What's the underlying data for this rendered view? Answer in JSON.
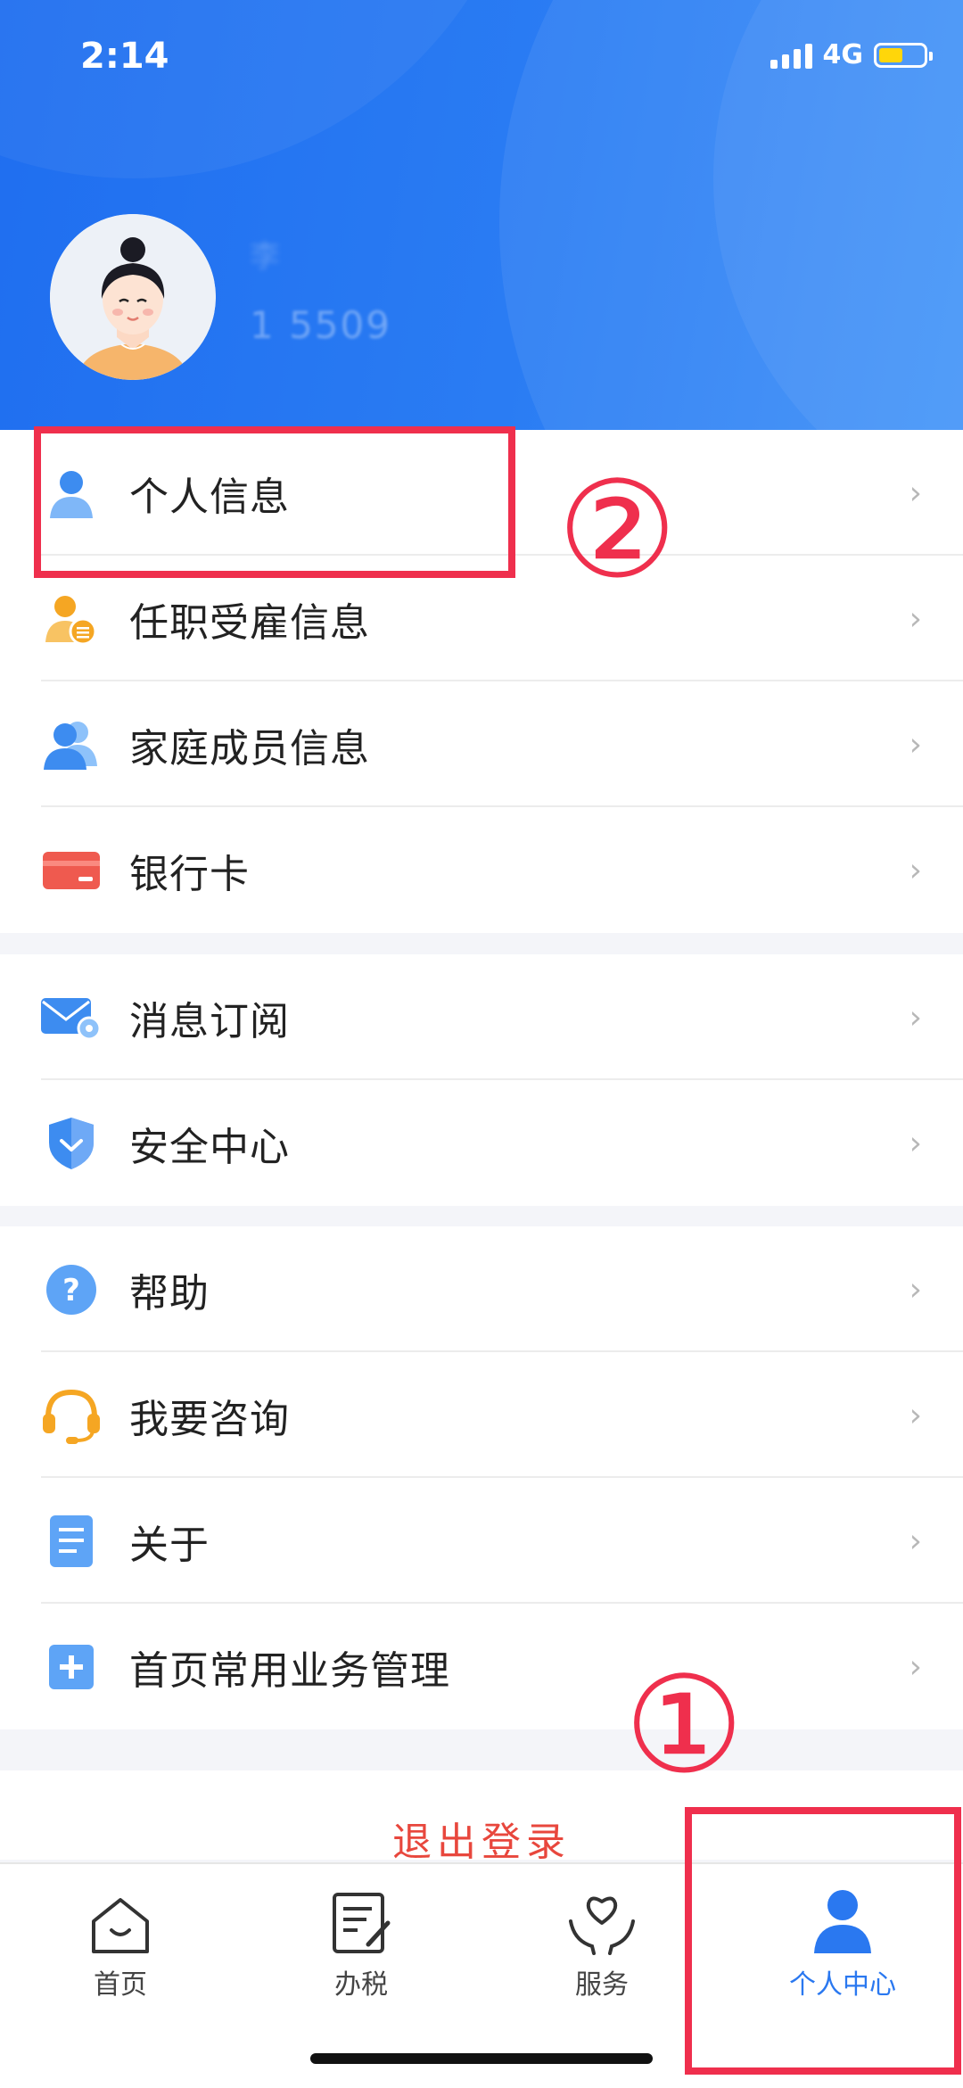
{
  "status_bar": {
    "time": "2:14",
    "network": "4G"
  },
  "profile": {
    "name_blurred": "李",
    "phone_masked": "1     5509"
  },
  "menu_groups": [
    [
      {
        "label": "个人信息",
        "icon": "person-icon"
      },
      {
        "label": "任职受雇信息",
        "icon": "employment-icon"
      },
      {
        "label": "家庭成员信息",
        "icon": "family-icon"
      },
      {
        "label": "银行卡",
        "icon": "bank-card-icon"
      }
    ],
    [
      {
        "label": "消息订阅",
        "icon": "mail-settings-icon"
      },
      {
        "label": "安全中心",
        "icon": "shield-icon"
      }
    ],
    [
      {
        "label": "帮助",
        "icon": "help-icon"
      },
      {
        "label": "我要咨询",
        "icon": "headset-icon"
      },
      {
        "label": "关于",
        "icon": "document-icon"
      },
      {
        "label": "首页常用业务管理",
        "icon": "plus-square-icon"
      }
    ]
  ],
  "logout_label": "退出登录",
  "tabbar": [
    {
      "label": "首页",
      "icon": "home-icon"
    },
    {
      "label": "办税",
      "icon": "tax-form-icon"
    },
    {
      "label": "服务",
      "icon": "heart-hands-icon"
    },
    {
      "label": "个人中心",
      "icon": "profile-icon",
      "active": true
    }
  ],
  "annotations": {
    "one": "①",
    "two": "②"
  },
  "colors": {
    "primary": "#2a78f0",
    "annotation": "#ef2f4d",
    "logout": "#e8473d"
  }
}
